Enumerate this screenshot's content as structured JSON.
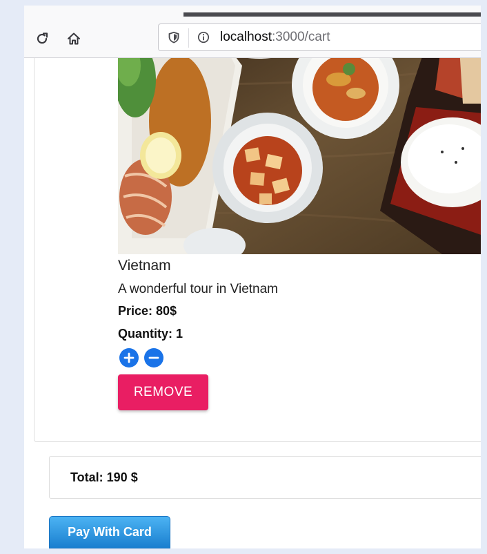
{
  "browser": {
    "url_host": "localhost",
    "url_path": ":3000/cart"
  },
  "cart_item": {
    "name": "Vietnam",
    "description": "A wonderful tour in Vietnam",
    "price": "Price: 80$",
    "quantity": "Quantity: 1",
    "remove_label": "REMOVE"
  },
  "summary": {
    "total": "Total: 190 $",
    "pay_label": "Pay With Card"
  },
  "colors": {
    "remove": "#e91e63",
    "qty_buttons": "#1a73e8",
    "pay": "#2a90dd"
  },
  "icons": [
    "reload-icon",
    "home-icon",
    "shield-icon",
    "info-icon",
    "plus-icon",
    "minus-icon"
  ]
}
